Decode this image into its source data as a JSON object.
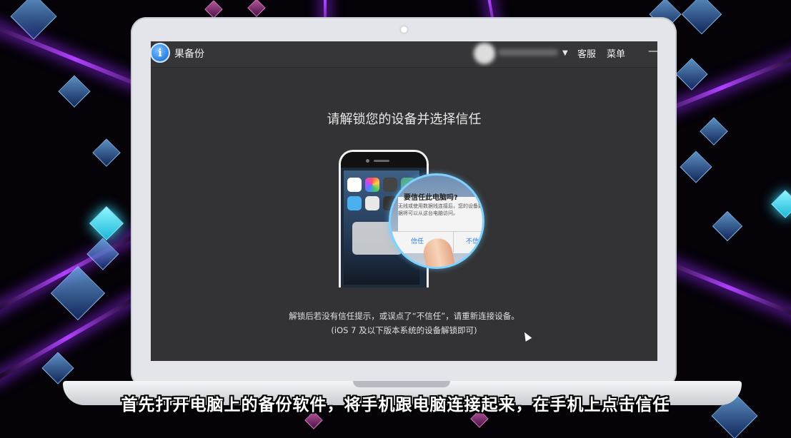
{
  "app": {
    "title": "果备份",
    "logo_icon_text": "i"
  },
  "header": {
    "service_label": "客服",
    "menu_label": "菜单",
    "minimize_label": "—",
    "dropdown_icon": "▼"
  },
  "main": {
    "heading": "请解锁您的设备并选择信任",
    "dialog": {
      "title": "要信任此电脑吗?",
      "body": "无线或使用数据线连接后，您的设备数据将可以从这台电脑访问。",
      "trust_label": "信任",
      "untrust_label": "不信"
    },
    "note_line1": "解锁后若没有信任提示，或误点了“不信任”，请重新连接设备。",
    "note_line2": "(iOS 7 及以下版本系统的设备解锁即可)"
  },
  "subtitle": "首先打开电脑上的备份软件，将手机跟电脑连接起来，在手机上点击信任",
  "colors": {
    "window_bg": "#333335",
    "accent_blue": "#2a7fe0",
    "beam_purple": "#b040ff"
  }
}
